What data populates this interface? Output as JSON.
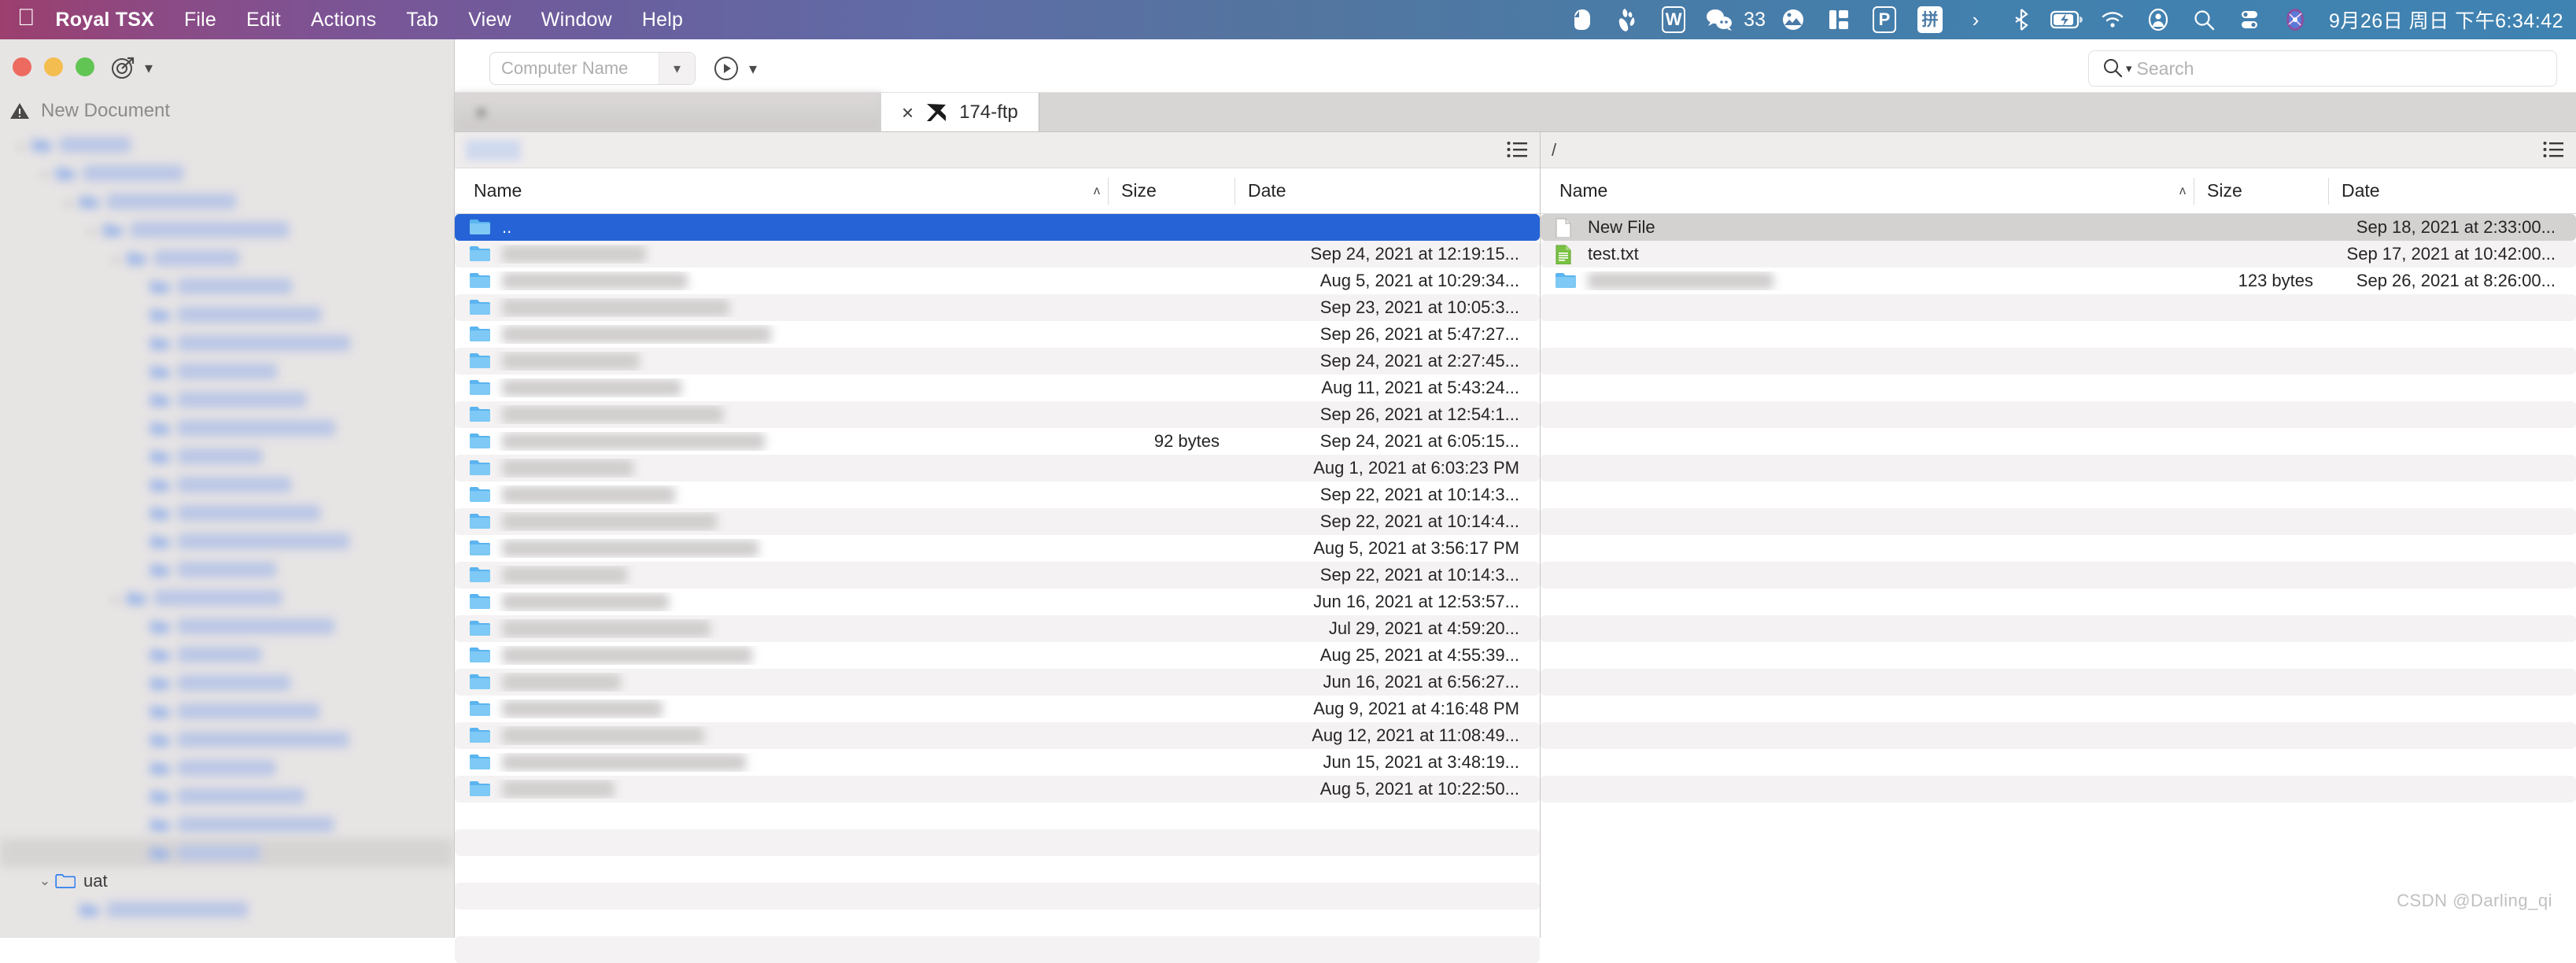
{
  "menubar": {
    "apple_glyph": "",
    "items": [
      {
        "label": "Royal TSX",
        "bold": true
      },
      {
        "label": "File",
        "bold": false
      },
      {
        "label": "Edit",
        "bold": false
      },
      {
        "label": "Actions",
        "bold": false
      },
      {
        "label": "Tab",
        "bold": false
      },
      {
        "label": "View",
        "bold": false
      },
      {
        "label": "Window",
        "bold": false
      },
      {
        "label": "Help",
        "bold": false
      }
    ],
    "tray": [
      {
        "name": "evernote-icon"
      },
      {
        "name": "baidu-netdisk-icon"
      },
      {
        "name": "wps-writer-icon",
        "glyph": "W"
      },
      {
        "name": "wechat-icon"
      },
      {
        "name": "wechat-unread-count",
        "glyph": "33"
      },
      {
        "name": "photos-icon"
      },
      {
        "name": "split-view-icon"
      },
      {
        "name": "parallels-icon",
        "glyph": "P"
      },
      {
        "name": "input-method-pinyin-icon",
        "glyph": "拼"
      },
      {
        "name": "overflow-chevron-icon",
        "glyph": "›"
      },
      {
        "name": "bluetooth-icon"
      },
      {
        "name": "battery-charging-icon"
      },
      {
        "name": "wifi-icon"
      },
      {
        "name": "user-account-icon"
      },
      {
        "name": "spotlight-search-icon"
      },
      {
        "name": "control-center-icon"
      },
      {
        "name": "siri-icon"
      }
    ],
    "clock": "9月26日 周日 下午6:34:42"
  },
  "sidebar": {
    "document_title": "New Document",
    "tree": [
      {
        "label": "",
        "indent": 0,
        "chevron": "⌄",
        "redacted": true
      },
      {
        "label": "",
        "indent": 1,
        "chevron": "⌄",
        "redacted": true
      },
      {
        "label": "",
        "indent": 2,
        "chevron": "⌄",
        "redacted": true
      },
      {
        "label": "",
        "indent": 3,
        "chevron": "⌄",
        "redacted": true
      },
      {
        "label": "",
        "indent": 4,
        "chevron": "⌄",
        "redacted": true
      },
      {
        "label": "",
        "indent": 5,
        "chevron": "",
        "redacted": true
      },
      {
        "label": "",
        "indent": 5,
        "chevron": "",
        "redacted": true
      },
      {
        "label": "",
        "indent": 5,
        "chevron": "",
        "redacted": true
      },
      {
        "label": "",
        "indent": 5,
        "chevron": "",
        "redacted": true
      },
      {
        "label": "",
        "indent": 5,
        "chevron": "",
        "redacted": true
      },
      {
        "label": "",
        "indent": 5,
        "chevron": "",
        "redacted": true
      },
      {
        "label": "",
        "indent": 5,
        "chevron": "",
        "redacted": true
      },
      {
        "label": "",
        "indent": 5,
        "chevron": "",
        "redacted": true
      },
      {
        "label": "",
        "indent": 5,
        "chevron": "",
        "redacted": true
      },
      {
        "label": "",
        "indent": 5,
        "chevron": "",
        "redacted": true
      },
      {
        "label": "",
        "indent": 5,
        "chevron": "",
        "redacted": true
      },
      {
        "label": "",
        "indent": 4,
        "chevron": "⌄",
        "redacted": true
      },
      {
        "label": "",
        "indent": 5,
        "chevron": "",
        "redacted": true
      },
      {
        "label": "",
        "indent": 5,
        "chevron": "",
        "redacted": true
      },
      {
        "label": "",
        "indent": 5,
        "chevron": "",
        "redacted": true
      },
      {
        "label": "",
        "indent": 5,
        "chevron": "",
        "redacted": true
      },
      {
        "label": "",
        "indent": 5,
        "chevron": "",
        "redacted": true
      },
      {
        "label": "",
        "indent": 5,
        "chevron": "",
        "redacted": true
      },
      {
        "label": "",
        "indent": 5,
        "chevron": "",
        "redacted": true
      },
      {
        "label": "",
        "indent": 5,
        "chevron": "",
        "redacted": true
      },
      {
        "label": "",
        "indent": 5,
        "chevron": "",
        "redacted": true,
        "selected": true
      },
      {
        "label": "uat",
        "indent": 1,
        "chevron": "⌄",
        "redacted": false
      },
      {
        "label": "",
        "indent": 2,
        "chevron": "",
        "redacted": true
      }
    ]
  },
  "toolbar": {
    "computer_name_placeholder": "Computer Name",
    "search_placeholder": "Search"
  },
  "tabs": [
    {
      "label": "",
      "active": false,
      "redacted": true
    },
    {
      "label": "174-ftp",
      "active": true,
      "redacted": false
    }
  ],
  "left_pane": {
    "path": "",
    "columns": [
      "Name",
      "Size",
      "Date"
    ],
    "sort_caret": "ʌ",
    "rows": [
      {
        "name": "..",
        "size": "",
        "date": "",
        "icon": "folder-icon",
        "selected": true
      },
      {
        "name": "",
        "size": "",
        "date": "Sep 24, 2021 at 12:19:15...",
        "icon": "folder-icon",
        "redacted": true
      },
      {
        "name": "",
        "size": "",
        "date": "Aug 5, 2021 at 10:29:34...",
        "icon": "folder-icon",
        "redacted": true
      },
      {
        "name": "",
        "size": "",
        "date": "Sep 23, 2021 at 10:05:3...",
        "icon": "folder-icon",
        "redacted": true
      },
      {
        "name": "",
        "size": "",
        "date": "Sep 26, 2021 at 5:47:27...",
        "icon": "folder-icon",
        "redacted": true
      },
      {
        "name": "",
        "size": "",
        "date": "Sep 24, 2021 at 2:27:45...",
        "icon": "folder-icon",
        "redacted": true
      },
      {
        "name": "",
        "size": "",
        "date": "Aug 11, 2021 at 5:43:24...",
        "icon": "folder-icon",
        "redacted": true
      },
      {
        "name": "",
        "size": "",
        "date": "Sep 26, 2021 at 12:54:1...",
        "icon": "folder-icon",
        "redacted": true
      },
      {
        "name": "",
        "size": "92 bytes",
        "date": "Sep 24, 2021 at 6:05:15...",
        "icon": "folder-icon",
        "redacted": true
      },
      {
        "name": "",
        "size": "",
        "date": "Aug 1, 2021 at 6:03:23 PM",
        "icon": "folder-icon",
        "redacted": true
      },
      {
        "name": "",
        "size": "",
        "date": "Sep 22, 2021 at 10:14:3...",
        "icon": "folder-icon",
        "redacted": true
      },
      {
        "name": "",
        "size": "",
        "date": "Sep 22, 2021 at 10:14:4...",
        "icon": "folder-icon",
        "redacted": true
      },
      {
        "name": "",
        "size": "",
        "date": "Aug 5, 2021 at 3:56:17 PM",
        "icon": "folder-icon",
        "redacted": true
      },
      {
        "name": "",
        "size": "",
        "date": "Sep 22, 2021 at 10:14:3...",
        "icon": "folder-icon",
        "redacted": true
      },
      {
        "name": "",
        "size": "",
        "date": "Jun 16, 2021 at 12:53:57...",
        "icon": "folder-icon",
        "redacted": true
      },
      {
        "name": "",
        "size": "",
        "date": "Jul 29, 2021 at 4:59:20...",
        "icon": "folder-icon",
        "redacted": true
      },
      {
        "name": "",
        "size": "",
        "date": "Aug 25, 2021 at 4:55:39...",
        "icon": "folder-icon",
        "redacted": true
      },
      {
        "name": "",
        "size": "",
        "date": "Jun 16, 2021 at 6:56:27...",
        "icon": "folder-icon",
        "redacted": true
      },
      {
        "name": "",
        "size": "",
        "date": "Aug 9, 2021 at 4:16:48 PM",
        "icon": "folder-icon",
        "redacted": true
      },
      {
        "name": "",
        "size": "",
        "date": "Aug 12, 2021 at 11:08:49...",
        "icon": "folder-icon",
        "redacted": true
      },
      {
        "name": "",
        "size": "",
        "date": "Jun 15, 2021 at 3:48:19...",
        "icon": "folder-icon",
        "redacted": true
      },
      {
        "name": "",
        "size": "",
        "date": "Aug 5, 2021 at 10:22:50...",
        "icon": "folder-icon",
        "redacted": true
      }
    ],
    "empty_row_count": 6
  },
  "right_pane": {
    "path": "/",
    "columns": [
      "Name",
      "Size",
      "Date"
    ],
    "sort_caret": "ʌ",
    "rows": [
      {
        "name": "New File",
        "size": "",
        "date": "Sep 18, 2021 at 2:33:00...",
        "icon": "blank-file-icon",
        "selected": true
      },
      {
        "name": "test.txt",
        "size": "",
        "date": "Sep 17, 2021 at 10:42:00...",
        "icon": "text-file-icon"
      },
      {
        "name": "",
        "size": "123 bytes",
        "date": "Sep 26, 2021 at 8:26:00...",
        "icon": "folder-icon",
        "redacted": true
      }
    ],
    "empty_row_count": 20
  },
  "watermark": "CSDN @Darling_qi",
  "colors": {
    "selection_blue": "#2563d6",
    "selection_gray": "#d4d1d1",
    "menubar_left": "#9c3f6e",
    "menubar_right": "#3f83b2",
    "folder_blue": "#5ab4ef",
    "text_green": "#7ac143"
  }
}
